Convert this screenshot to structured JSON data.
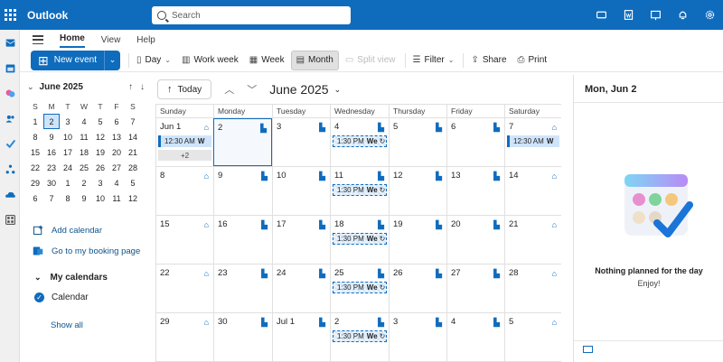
{
  "app": {
    "title": "Outlook",
    "search_placeholder": "Search"
  },
  "ribbon": {
    "tabs": [
      "Home",
      "View",
      "Help"
    ],
    "active_tab": "Home"
  },
  "toolbar": {
    "new_event": "New event",
    "day": "Day",
    "work_week": "Work week",
    "week": "Week",
    "month": "Month",
    "split_view": "Split view",
    "filter": "Filter",
    "share": "Share",
    "print": "Print"
  },
  "mini_calendar": {
    "title": "June 2025",
    "dow": [
      "S",
      "M",
      "T",
      "W",
      "T",
      "F",
      "S"
    ],
    "weeks": [
      [
        "1",
        "2",
        "3",
        "4",
        "5",
        "6",
        "7"
      ],
      [
        "8",
        "9",
        "10",
        "11",
        "12",
        "13",
        "14"
      ],
      [
        "15",
        "16",
        "17",
        "18",
        "19",
        "20",
        "21"
      ],
      [
        "22",
        "23",
        "24",
        "25",
        "26",
        "27",
        "28"
      ],
      [
        "29",
        "30",
        "1",
        "2",
        "3",
        "4",
        "5"
      ],
      [
        "6",
        "7",
        "8",
        "9",
        "10",
        "11",
        "12"
      ]
    ]
  },
  "sidebar": {
    "add_calendar": "Add calendar",
    "booking_page": "Go to my booking page",
    "my_calendars": "My calendars",
    "calendar": "Calendar",
    "show_all": "Show all"
  },
  "calendar": {
    "today_label": "Today",
    "month_title": "June 2025",
    "days_of_week": [
      "Sunday",
      "Monday",
      "Tuesday",
      "Wednesday",
      "Thursday",
      "Friday",
      "Saturday"
    ],
    "weeks": [
      [
        "Jun 1",
        "2",
        "3",
        "4",
        "5",
        "6",
        "7"
      ],
      [
        "8",
        "9",
        "10",
        "11",
        "12",
        "13",
        "14"
      ],
      [
        "15",
        "16",
        "17",
        "18",
        "19",
        "20",
        "21"
      ],
      [
        "22",
        "23",
        "24",
        "25",
        "26",
        "27",
        "28"
      ],
      [
        "29",
        "30",
        "Jul 1",
        "2",
        "3",
        "4",
        "5"
      ]
    ],
    "event_morning": {
      "time": "12:30 AM",
      "title": "W"
    },
    "event_recurring": {
      "time": "1:30 PM",
      "title": "We"
    },
    "more_label": "+2"
  },
  "right_pane": {
    "date": "Mon, Jun 2",
    "nothing": "Nothing planned for the day",
    "enjoy": "Enjoy!"
  },
  "colors": {
    "brand": "#0f6cbd"
  }
}
